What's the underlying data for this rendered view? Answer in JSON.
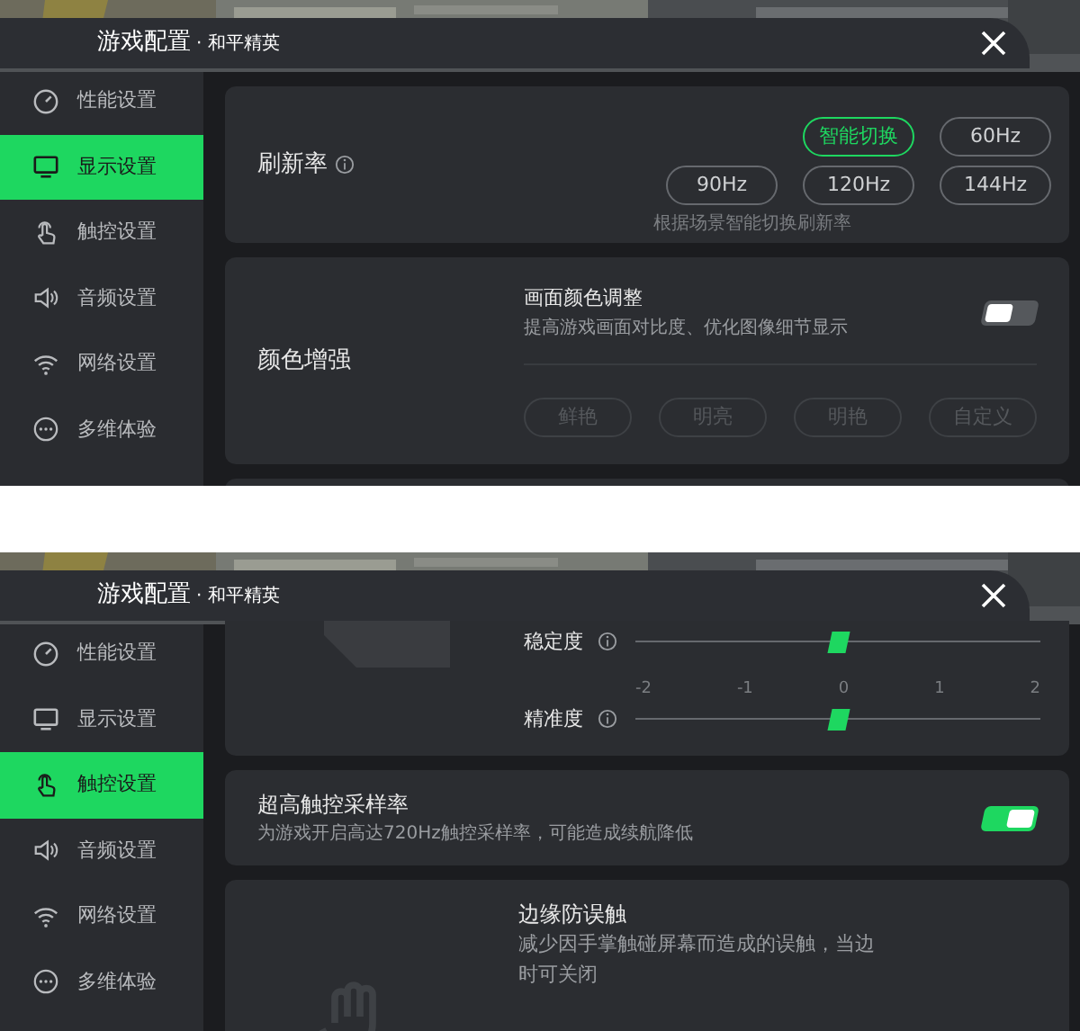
{
  "panels": [
    {
      "header": {
        "title": "游戏配置",
        "subtitle": "· 和平精英"
      },
      "sidebar": [
        {
          "label": "性能设置",
          "selected": false
        },
        {
          "label": "显示设置",
          "selected": true
        },
        {
          "label": "触控设置",
          "selected": false
        },
        {
          "label": "音频设置",
          "selected": false
        },
        {
          "label": "网络设置",
          "selected": false
        },
        {
          "label": "多维体验",
          "selected": false
        }
      ],
      "cards": [
        {
          "kind": "options",
          "title": "刷新率",
          "options": [
            {
              "label": "智能切换",
              "selected": true
            },
            {
              "label": "60Hz",
              "selected": false
            },
            {
              "label": "90Hz",
              "selected": false
            },
            {
              "label": "120Hz",
              "selected": false
            },
            {
              "label": "144Hz",
              "selected": false
            }
          ],
          "hint": "根据场景智能切换刷新率"
        },
        {
          "kind": "color",
          "title": "颜色增强",
          "setting": "画面颜色调整",
          "description": "提高游戏画面对比度、优化图像细节显示",
          "on": false,
          "presets": [
            {
              "label": "鲜艳",
              "disabled": true
            },
            {
              "label": "明亮",
              "disabled": true
            },
            {
              "label": "明艳",
              "disabled": true
            },
            {
              "label": "自定义",
              "disabled": true
            }
          ]
        },
        {
          "kind": "stub"
        }
      ]
    },
    {
      "header": {
        "title": "游戏配置",
        "subtitle": "· 和平精英"
      },
      "sidebar": [
        {
          "label": "性能设置",
          "selected": false
        },
        {
          "label": "显示设置",
          "selected": false
        },
        {
          "label": "触控设置",
          "selected": true
        },
        {
          "label": "音频设置",
          "selected": false
        },
        {
          "label": "网络设置",
          "selected": false
        },
        {
          "label": "多维体验",
          "selected": false
        }
      ],
      "cards": [
        {
          "kind": "sliders",
          "sliders": [
            {
              "label": "稳定度",
              "level": 0.5
            },
            {
              "label": "精准度",
              "level": 0.5,
              "ticks": [
                "-2",
                "-1",
                "0",
                "1",
                "2"
              ]
            }
          ]
        },
        {
          "kind": "toggle",
          "title": "超高触控采样率",
          "description": "为游戏开启高达720Hz触控采样率，可能造成续航降低",
          "on": true
        },
        {
          "kind": "edge",
          "title": "边缘防误触",
          "description_lines": [
            "减少因手掌触碰屏幕而造成的误触，当边",
            "时可关闭"
          ]
        }
      ]
    }
  ]
}
